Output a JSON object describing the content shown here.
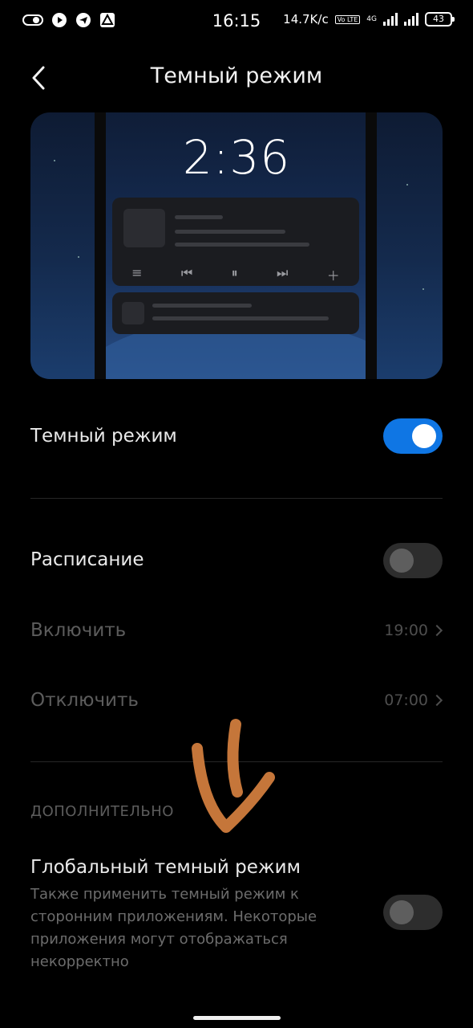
{
  "status_bar": {
    "time": "16:15",
    "network_speed": "14.7K/c",
    "volte": "Vo LTE",
    "network_type": "4G",
    "battery": "43"
  },
  "header": {
    "title": "Темный режим"
  },
  "preview": {
    "clock": "2:36"
  },
  "dark_mode": {
    "label": "Темный режим",
    "enabled": true
  },
  "schedule": {
    "label": "Расписание",
    "enabled": false,
    "on": {
      "label": "Включить",
      "value": "19:00"
    },
    "off": {
      "label": "Отключить",
      "value": "07:00"
    }
  },
  "additional": {
    "header": "ДОПОЛНИТЕЛЬНО",
    "global_dark": {
      "title": "Глобальный темный режим",
      "description": "Также применить темный режим к сторонним приложениям. Некоторые приложения могут отображаться некорректно",
      "enabled": false
    }
  },
  "colors": {
    "accent": "#0f76e4",
    "annotation": "#c5763a"
  }
}
